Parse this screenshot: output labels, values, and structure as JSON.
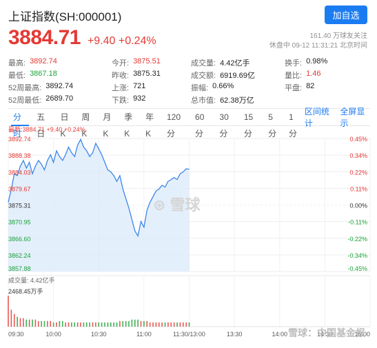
{
  "header": {
    "title": "上证指数(SH:000001)",
    "follow_button": "加自选",
    "price": "3884.71",
    "change": "+9.40 +0.24%",
    "followers": "161.40 万球友关注",
    "status": "休盘中 09-12 11:31:21 北京时间"
  },
  "stats": [
    [
      {
        "k": "最高:",
        "v": "3892.74",
        "c": "red"
      },
      {
        "k": "今开:",
        "v": "3875.51",
        "c": "red"
      },
      {
        "k": "成交量:",
        "v": "4.42亿手",
        "c": ""
      },
      {
        "k": "换手:",
        "v": "0.98%",
        "c": ""
      }
    ],
    [
      {
        "k": "最低:",
        "v": "3867.18",
        "c": "green"
      },
      {
        "k": "昨收:",
        "v": "3875.31",
        "c": ""
      },
      {
        "k": "成交额:",
        "v": "6919.69亿",
        "c": ""
      },
      {
        "k": "量比:",
        "v": "1.46",
        "c": "red"
      }
    ],
    [
      {
        "k": "52周最高:",
        "v": "3892.74",
        "c": ""
      },
      {
        "k": "上涨:",
        "v": "721",
        "c": ""
      },
      {
        "k": "振幅:",
        "v": "0.66%",
        "c": ""
      },
      {
        "k": "平盘:",
        "v": "82",
        "c": ""
      }
    ],
    [
      {
        "k": "52周最低:",
        "v": "2689.70",
        "c": ""
      },
      {
        "k": "下跌:",
        "v": "932",
        "c": ""
      },
      {
        "k": "总市值:",
        "v": "62.38万亿",
        "c": ""
      },
      {
        "k": "",
        "v": "",
        "c": ""
      }
    ]
  ],
  "tabs": [
    "分时",
    "五日",
    "日K",
    "周K",
    "月K",
    "季K",
    "年K",
    "120分",
    "60分",
    "30分",
    "15分",
    "5分",
    "1分"
  ],
  "active_tab": "分时",
  "tab_links": [
    "区间统计",
    "全屏显示"
  ],
  "chart_top_label": "最新:3884.71 +9.40 +0.24%",
  "volume_label": "成交量: 4.42亿手",
  "volume_axis_max": "2468.45万手",
  "watermark": "雪球",
  "footer_watermark": "雪球：中国基金报",
  "colors": {
    "up": "#e53935",
    "down": "#1aa337",
    "line": "#3a86e8",
    "fill": "#dbeafb",
    "accent": "#1b7cf2"
  },
  "chart_data": {
    "type": "line",
    "title": "",
    "prev_close": 3875.31,
    "ylim": [
      3857.88,
      3892.74
    ],
    "y_ticks_left": [
      "3892.74",
      "3888.38",
      "3884.03",
      "3879.67",
      "3875.31",
      "3870.95",
      "3866.60",
      "3862.24",
      "3857.88"
    ],
    "y_ticks_right": [
      "0.45%",
      "0.34%",
      "0.22%",
      "0.11%",
      "0.00%",
      "-0.11%",
      "-0.22%",
      "-0.34%",
      "-0.45%"
    ],
    "x_ticks": [
      "09:30",
      "10:00",
      "10:30",
      "11:00",
      "11:30/13:00",
      "13:30",
      "14:00",
      "14:30",
      "15:00"
    ],
    "series": [
      {
        "x_minutes": [
          0,
          2,
          4,
          6,
          8,
          10,
          12,
          14,
          16,
          18,
          20,
          22,
          24,
          26,
          28,
          30,
          32,
          34,
          36,
          38,
          40,
          42,
          44,
          46,
          48,
          50,
          52,
          54,
          56,
          58,
          60,
          62,
          64,
          66,
          68,
          70,
          72,
          74,
          76,
          78,
          80,
          82,
          84,
          86,
          88,
          90,
          92,
          94,
          96,
          98,
          100,
          102,
          104,
          106,
          108,
          110,
          112,
          114,
          116,
          118,
          120
        ],
        "values": [
          3876.0,
          3879.5,
          3883.5,
          3883.0,
          3885.5,
          3887.0,
          3885.0,
          3886.5,
          3883.5,
          3885.5,
          3887.0,
          3886.0,
          3884.5,
          3887.0,
          3888.5,
          3886.5,
          3889.5,
          3888.0,
          3887.0,
          3888.5,
          3890.5,
          3889.0,
          3888.0,
          3891.0,
          3892.5,
          3890.5,
          3889.5,
          3888.0,
          3889.0,
          3891.5,
          3890.0,
          3888.5,
          3886.5,
          3884.5,
          3884.0,
          3883.0,
          3881.5,
          3883.0,
          3879.5,
          3877.0,
          3874.5,
          3871.5,
          3868.5,
          3867.2,
          3871.0,
          3869.5,
          3874.0,
          3876.0,
          3877.5,
          3879.0,
          3879.5,
          3880.5,
          3880.0,
          3881.5,
          3882.0,
          3882.5,
          3882.0,
          3883.5,
          3884.0,
          3884.8,
          3884.71
        ]
      }
    ],
    "volume": [
      22,
      12,
      9,
      7,
      6,
      6,
      5,
      5,
      5,
      5,
      4,
      4,
      4,
      4,
      4,
      3,
      3,
      4,
      4,
      3,
      3,
      3,
      3,
      3,
      3,
      3,
      3,
      3,
      3,
      3,
      3,
      3,
      3,
      3,
      3,
      3,
      3,
      4,
      4,
      4,
      4,
      5,
      5,
      5,
      4,
      4,
      4,
      3,
      3,
      3,
      3,
      3,
      3,
      3,
      3,
      3,
      3,
      3,
      3,
      3,
      3
    ],
    "volume_max": 2468.45
  }
}
